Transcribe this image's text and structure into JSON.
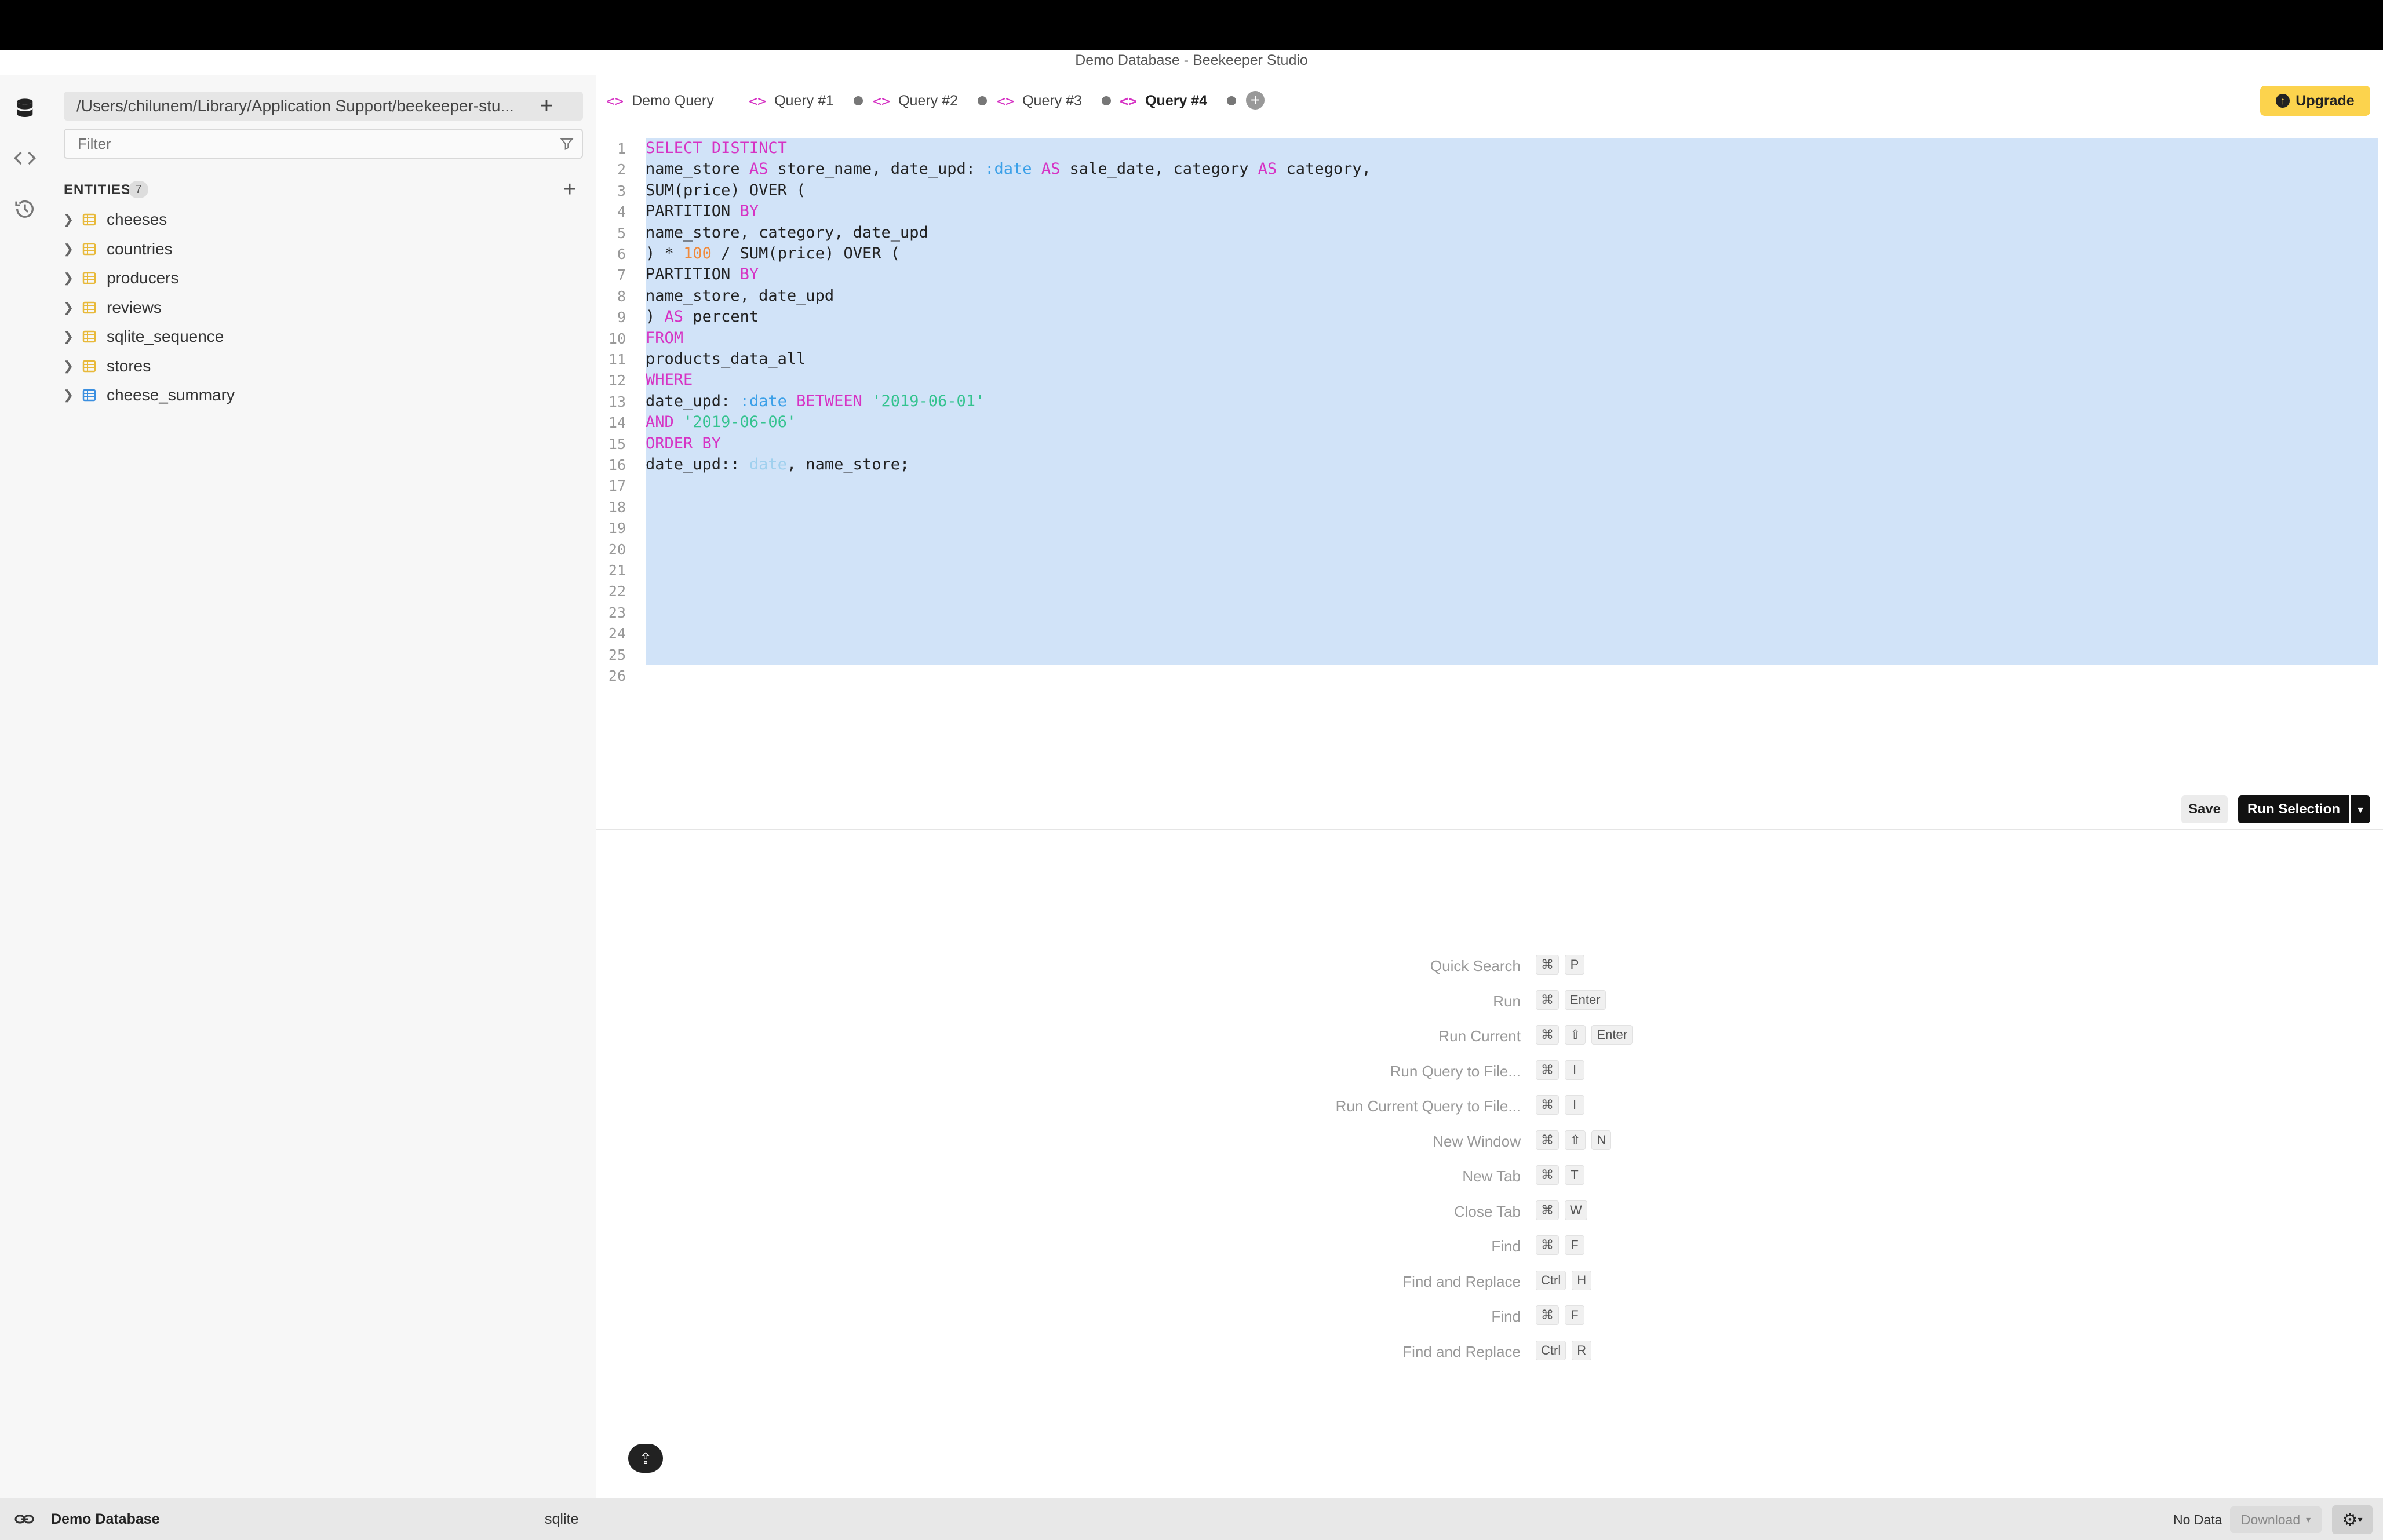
{
  "window": {
    "title": "Demo Database - Beekeeper Studio"
  },
  "sidebar": {
    "path": "/Users/chilunem/Library/Application Support/beekeeper-stu...",
    "filter_placeholder": "Filter",
    "entities_label": "ENTITIES",
    "entities_count": "7",
    "entities": [
      {
        "name": "cheeses",
        "kind": "table"
      },
      {
        "name": "countries",
        "kind": "table"
      },
      {
        "name": "producers",
        "kind": "table"
      },
      {
        "name": "reviews",
        "kind": "table"
      },
      {
        "name": "sqlite_sequence",
        "kind": "table"
      },
      {
        "name": "stores",
        "kind": "table"
      },
      {
        "name": "cheese_summary",
        "kind": "view"
      }
    ]
  },
  "tabs": [
    {
      "label": "Demo Query",
      "unsaved": false,
      "active": false
    },
    {
      "label": "Query #1",
      "unsaved": true,
      "active": false
    },
    {
      "label": "Query #2",
      "unsaved": true,
      "active": false
    },
    {
      "label": "Query #3",
      "unsaved": true,
      "active": false
    },
    {
      "label": "Query #4",
      "unsaved": true,
      "active": true
    }
  ],
  "upgrade_label": "Upgrade",
  "editor": {
    "line_numbers": [
      "1",
      "2",
      "3",
      "4",
      "5",
      "6",
      "7",
      "8",
      "9",
      "10",
      "11",
      "12",
      "13",
      "14",
      "15",
      "16",
      "17",
      "18",
      "19",
      "20",
      "21",
      "22",
      "23",
      "24",
      "25",
      "26"
    ],
    "lines": [
      "SELECT DISTINCT",
      "name_store AS store_name, date_upd: :date AS sale_date, category AS category,",
      "SUM(price) OVER (",
      "PARTITION BY",
      "name_store, category, date_upd",
      ") * 100 / SUM(price) OVER (",
      "PARTITION BY",
      "name_store, date_upd",
      ") AS percent",
      "FROM",
      "products_data_all",
      "WHERE",
      "date_upd: :date BETWEEN '2019-06-01'",
      "AND '2019-06-06'",
      "ORDER BY",
      "date_upd:: date, name_store;"
    ]
  },
  "actions": {
    "save_label": "Save",
    "run_label": "Run Selection"
  },
  "shortcuts": [
    {
      "label": "Quick Search",
      "keys": [
        "⌘",
        "P"
      ]
    },
    {
      "label": "Run",
      "keys": [
        "⌘",
        "Enter"
      ]
    },
    {
      "label": "Run Current",
      "keys": [
        "⌘",
        "⇧",
        "Enter"
      ]
    },
    {
      "label": "Run Query to File...",
      "keys": [
        "⌘",
        "I"
      ]
    },
    {
      "label": "Run Current Query to File...",
      "keys": [
        "⌘",
        "I"
      ]
    },
    {
      "label": "New Window",
      "keys": [
        "⌘",
        "⇧",
        "N"
      ]
    },
    {
      "label": "New Tab",
      "keys": [
        "⌘",
        "T"
      ]
    },
    {
      "label": "Close Tab",
      "keys": [
        "⌘",
        "W"
      ]
    },
    {
      "label": "Find",
      "keys": [
        "⌘",
        "F"
      ]
    },
    {
      "label": "Find and Replace",
      "keys": [
        "Ctrl",
        "H"
      ]
    },
    {
      "label": "Find",
      "keys": [
        "⌘",
        "F"
      ]
    },
    {
      "label": "Find and Replace",
      "keys": [
        "Ctrl",
        "R"
      ]
    }
  ],
  "status": {
    "connection": "Demo Database",
    "db_type": "sqlite",
    "result": "No Data",
    "download_label": "Download"
  },
  "colors": {
    "accent": "#d633c4",
    "upgrade": "#fcd34d",
    "selection": "#d1e3f8",
    "table_icon": "#e8b93a",
    "view_icon": "#3b8fe0"
  }
}
